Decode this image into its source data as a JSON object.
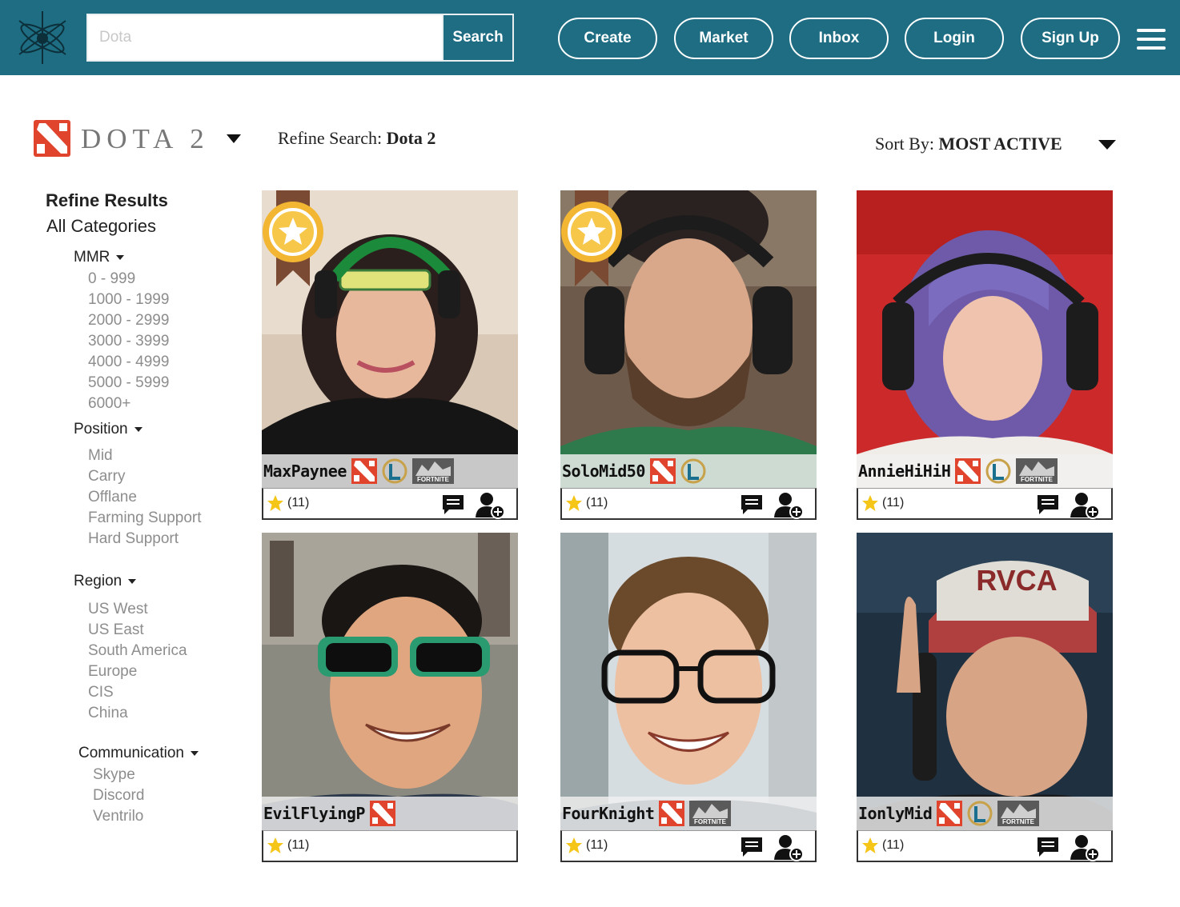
{
  "header": {
    "search_placeholder": "Dota",
    "search_button": "Search",
    "nav": [
      "Create",
      "Market",
      "Inbox",
      "Login",
      "Sign Up"
    ]
  },
  "game": {
    "name": "DOTA 2",
    "refine_search_label": "Refine Search:",
    "refine_search_value": "Dota 2",
    "sort_label": "Sort By:",
    "sort_value": "MOST ACTIVE"
  },
  "sidebar": {
    "title": "Refine Results",
    "subtitle": "All Categories",
    "mmr": {
      "label": "MMR",
      "options": [
        "0 - 999",
        "1000 - 1999",
        "2000 - 2999",
        "3000 - 3999",
        "4000 - 4999",
        "5000 - 5999",
        "6000+"
      ]
    },
    "position": {
      "label": "Position",
      "options": [
        "Mid",
        "Carry",
        "Offlane",
        "Farming Support",
        "Hard Support"
      ]
    },
    "region": {
      "label": "Region",
      "options": [
        "US West",
        "US East",
        "South America",
        "Europe",
        "CIS",
        "China"
      ]
    },
    "communication": {
      "label": "Communication",
      "options": [
        "Skype",
        "Discord",
        "Ventrilo"
      ]
    }
  },
  "players": [
    {
      "username": "MaxPaynee",
      "rating": "(11)",
      "games": [
        "dota",
        "lol",
        "fortnite"
      ],
      "featured": true
    },
    {
      "username": "SoloMid50",
      "rating": "(11)",
      "games": [
        "dota",
        "lol"
      ],
      "featured": true
    },
    {
      "username": "AnnieHiHiH",
      "rating": "(11)",
      "games": [
        "dota",
        "lol",
        "fortnite"
      ],
      "featured": false
    },
    {
      "username": "EvilFlyingP",
      "rating": "(11)",
      "games": [
        "dota"
      ],
      "featured": false
    },
    {
      "username": "FourKnight",
      "rating": "(11)",
      "games": [
        "dota",
        "fortnite"
      ],
      "featured": false
    },
    {
      "username": "IonlyMid",
      "rating": "(11)",
      "games": [
        "dota",
        "lol",
        "fortnite"
      ],
      "featured": false
    }
  ],
  "colors": {
    "header": "#1e6d82",
    "dota_red": "#e0442d",
    "lol_gold": "#c8a24a",
    "badge_gold": "#f2b632",
    "star": "#f5c518"
  }
}
